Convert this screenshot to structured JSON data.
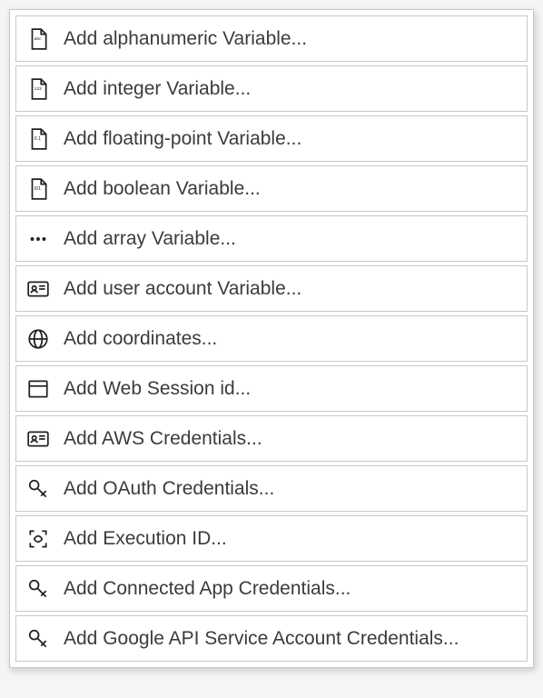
{
  "menu": {
    "items": [
      {
        "id": "alphanumeric",
        "icon": "file-abc-icon",
        "label": "Add alphanumeric Variable..."
      },
      {
        "id": "integer",
        "icon": "file-123-icon",
        "label": "Add integer Variable..."
      },
      {
        "id": "floating",
        "icon": "file-decimal-icon",
        "label": "Add floating-point Variable..."
      },
      {
        "id": "boolean",
        "icon": "file-bool-icon",
        "label": "Add boolean Variable..."
      },
      {
        "id": "array",
        "icon": "dots-icon",
        "label": "Add array Variable..."
      },
      {
        "id": "user-account",
        "icon": "id-card-icon",
        "label": "Add user account Variable..."
      },
      {
        "id": "coordinates",
        "icon": "globe-icon",
        "label": "Add coordinates..."
      },
      {
        "id": "web-session",
        "icon": "window-icon",
        "label": "Add Web Session id..."
      },
      {
        "id": "aws",
        "icon": "id-card-icon",
        "label": "Add AWS Credentials..."
      },
      {
        "id": "oauth",
        "icon": "key-icon",
        "label": "Add OAuth Credentials..."
      },
      {
        "id": "execution",
        "icon": "scan-icon",
        "label": "Add Execution ID..."
      },
      {
        "id": "connected-app",
        "icon": "key-icon",
        "label": "Add Connected App Credentials..."
      },
      {
        "id": "google-api",
        "icon": "key-icon",
        "label": "Add Google API Service Account Credentials..."
      }
    ]
  }
}
